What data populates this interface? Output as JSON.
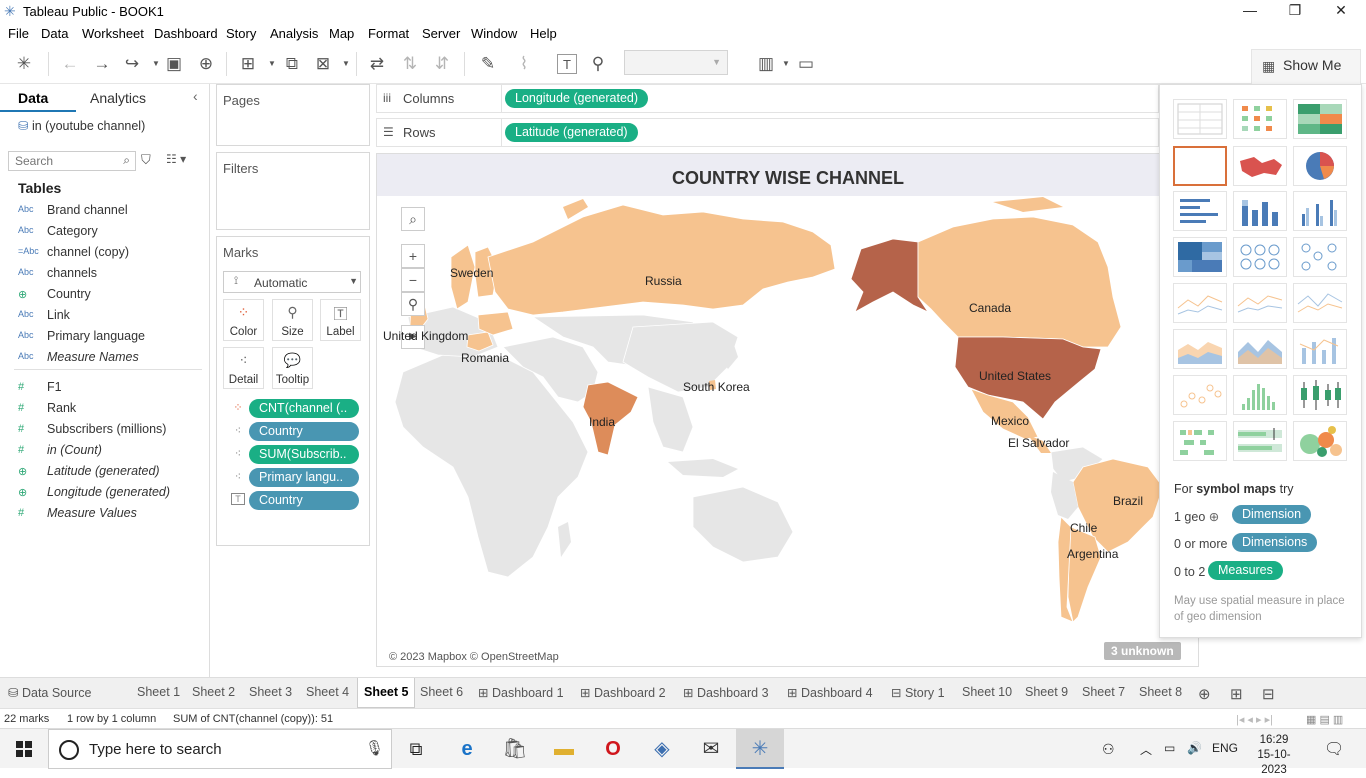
{
  "window": {
    "title": "Tableau Public - BOOK1",
    "minimize": "—",
    "restore": "❐",
    "close": "✕"
  },
  "menu": [
    "File",
    "Data",
    "Worksheet",
    "Dashboard",
    "Story",
    "Analysis",
    "Map",
    "Format",
    "Server",
    "Window",
    "Help"
  ],
  "showme": {
    "label": "Show Me"
  },
  "datapane": {
    "tab_data": "Data",
    "tab_analytics": "Analytics",
    "datasource": "in (youtube channel)",
    "search_placeholder": "Search",
    "tables_heading": "Tables",
    "fields": [
      {
        "type": "Abc",
        "name": "Brand channel",
        "italic": false
      },
      {
        "type": "Abc",
        "name": "Category",
        "italic": false
      },
      {
        "type": "=Abc",
        "name": "channel (copy)",
        "italic": false
      },
      {
        "type": "Abc",
        "name": "channels",
        "italic": false
      },
      {
        "type": "globe",
        "name": "Country",
        "italic": false
      },
      {
        "type": "Abc",
        "name": "Link",
        "italic": false
      },
      {
        "type": "Abc",
        "name": "Primary language",
        "italic": false
      },
      {
        "type": "Abc",
        "name": "Measure Names",
        "italic": true
      },
      {
        "type": "#",
        "name": "F1",
        "italic": false
      },
      {
        "type": "#",
        "name": "Rank",
        "italic": false
      },
      {
        "type": "#",
        "name": "Subscribers (millions)",
        "italic": false
      },
      {
        "type": "#",
        "name": "in (Count)",
        "italic": true
      },
      {
        "type": "globe",
        "name": "Latitude (generated)",
        "italic": true
      },
      {
        "type": "globe",
        "name": "Longitude (generated)",
        "italic": true
      },
      {
        "type": "#",
        "name": "Measure Values",
        "italic": true
      }
    ]
  },
  "cards": {
    "pages": "Pages",
    "filters": "Filters",
    "marks": "Marks",
    "mark_type": "Automatic",
    "buttons": [
      "Color",
      "Size",
      "Label",
      "Detail",
      "Tooltip"
    ],
    "pills": [
      {
        "icon": "color-dots",
        "text": "CNT(channel (..",
        "color": "green"
      },
      {
        "icon": "detail-dots",
        "text": "Country",
        "color": "blue"
      },
      {
        "icon": "detail-dots",
        "text": "SUM(Subscrib..",
        "color": "green"
      },
      {
        "icon": "detail-dots",
        "text": "Primary langu..",
        "color": "blue"
      },
      {
        "icon": "label-T",
        "text": "Country",
        "color": "blue"
      }
    ]
  },
  "shelves": {
    "columns_label": "Columns",
    "columns_pill": "Longitude (generated)",
    "rows_label": "Rows",
    "rows_pill": "Latitude (generated)"
  },
  "viz": {
    "title": "COUNTRY WISE CHANNEL",
    "copyright": "© 2023 Mapbox © OpenStreetMap",
    "unknown": "3 unknown",
    "country_labels": [
      "Russia",
      "Sweden",
      "United Kingdom",
      "Romania",
      "South Korea",
      "India",
      "Canada",
      "United States",
      "Mexico",
      "El Salvador",
      "Brazil",
      "Chile",
      "Argentina"
    ]
  },
  "showme_panel": {
    "hint_prefix": "For ",
    "hint_bold": "symbol maps",
    "hint_suffix": " try",
    "req": [
      {
        "label": "1 geo",
        "pill": "Dimension",
        "color": "blue"
      },
      {
        "label": "0 or more",
        "pill": "Dimensions",
        "color": "blue"
      },
      {
        "label": "0 to 2",
        "pill": "Measures",
        "color": "green"
      }
    ],
    "note": "May use spatial measure in place of geo dimension"
  },
  "tabs": [
    "Data Source",
    "Sheet 1",
    "Sheet 2",
    "Sheet 3",
    "Sheet 4",
    "Sheet 5",
    "Sheet 6",
    "Dashboard 1",
    "Dashboard 2",
    "Dashboard 3",
    "Dashboard 4",
    "Story 1",
    "Sheet 10",
    "Sheet 9",
    "Sheet 7",
    "Sheet 8"
  ],
  "active_tab": "Sheet 5",
  "status": {
    "marks": "22 marks",
    "rows": "1 row by 1 column",
    "sum": "SUM of CNT(channel (copy)): 51"
  },
  "taskbar": {
    "search_placeholder": "Type here to search",
    "lang": "ENG",
    "time": "16:29",
    "date": "15-10-2023"
  },
  "colors": {
    "dark": "#b5634a",
    "mid": "#dd8c5a",
    "light": "#f6c38f",
    "nodata": "#e6e6e6",
    "green_pill": "#1aaf85",
    "blue_pill": "#4996b2"
  }
}
